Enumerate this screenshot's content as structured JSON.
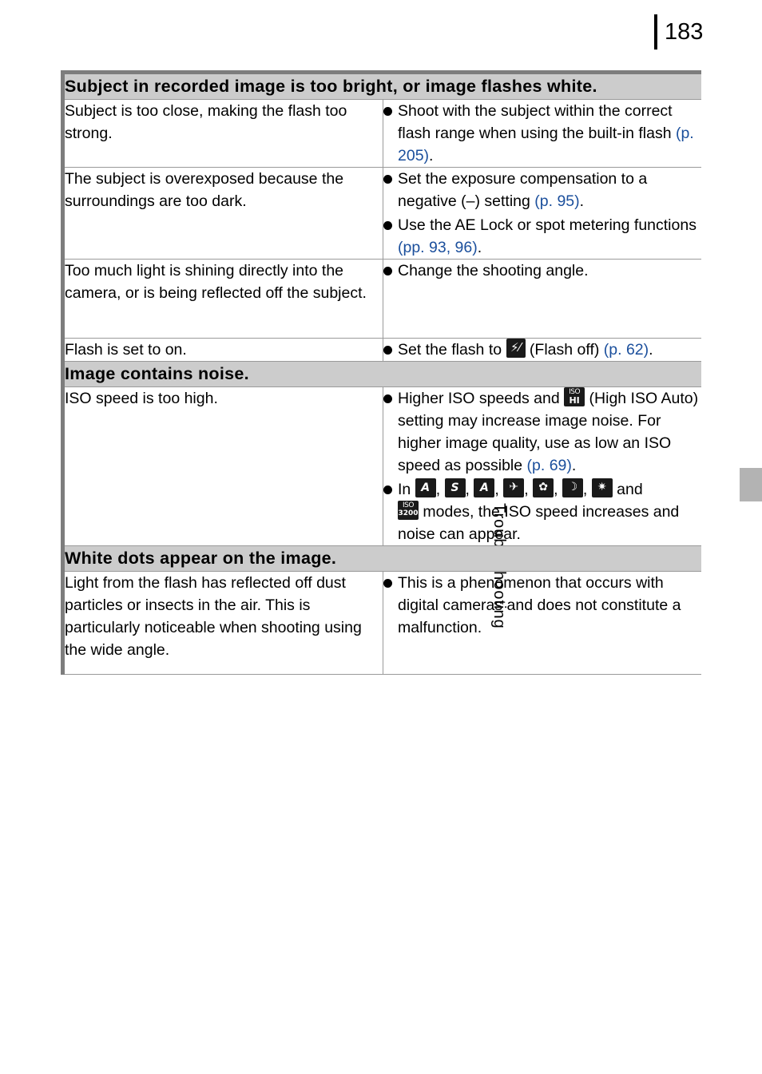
{
  "page": {
    "number": "183",
    "side_tab_label": "Troubleshooting"
  },
  "sections": [
    {
      "heading": "Subject in recorded image is too bright, or image flashes white.",
      "rows": [
        {
          "cause": "Subject is too close, making the flash too strong.",
          "remedies": [
            {
              "pre": "Shoot with the subject within the correct flash range when using the built-in flash ",
              "ref": "(p. 205)",
              "post": "."
            }
          ]
        },
        {
          "cause": "The subject is overexposed because the surroundings are too dark.",
          "remedies": [
            {
              "pre": "Set the exposure compensation to a negative (–) setting ",
              "ref": "(p. 95)",
              "post": "."
            },
            {
              "pre": "Use the AE Lock or spot metering functions ",
              "ref": "(pp. 93, 96)",
              "post": "."
            }
          ]
        },
        {
          "cause": "Too much light is shining directly into the camera, or is being reflected off the subject.",
          "remedies": [
            {
              "pre": "Change the shooting angle.",
              "ref": "",
              "post": ""
            }
          ]
        },
        {
          "cause": "Flash is set to on.",
          "remedies": [
            {
              "pre": "Set the flash to ",
              "icon": "flash-off-icon",
              "mid": " (Flash off) ",
              "ref": "(p. 62)",
              "post": "."
            }
          ]
        }
      ]
    },
    {
      "heading": "Image contains noise.",
      "rows": [
        {
          "cause": "ISO speed is too high.",
          "remedies": [
            {
              "pre": "Higher ISO speeds and ",
              "icon": "iso-hi-icon",
              "mid": " (High ISO Auto) setting may increase image noise. For higher image quality, use as low an ISO speed as possible ",
              "ref": "(p. 69)",
              "post": "."
            },
            {
              "pre": "In ",
              "icons": [
                "auto-iso-icon",
                "long-shutter-icon",
                "indoor-icon",
                "kids-pets-icon",
                "foliage-icon",
                "night-snapshot-icon",
                "fireworks-icon"
              ],
              "mid": " and ",
              "icon_last": "iso-3200-icon",
              "post": " modes, the ISO speed increases and noise can appear."
            }
          ]
        }
      ]
    },
    {
      "heading": "White dots appear on the image.",
      "rows": [
        {
          "cause": "Light from the flash has reflected off dust particles or insects in the air. This is particularly noticeable when shooting using the wide angle.",
          "remedies": [
            {
              "pre": "This is a phenomenon that occurs with digital cameras and does not constitute a malfunction.",
              "ref": "",
              "post": ""
            }
          ]
        }
      ]
    }
  ],
  "icon_labels": {
    "flash-off-icon": "flash-off",
    "iso-hi-icon": "ISO HI",
    "iso-3200-icon": "ISO 3200",
    "auto-iso-icon": "auto",
    "long-shutter-icon": "long-shutter",
    "indoor-icon": "indoor",
    "kids-pets-icon": "kids-and-pets",
    "foliage-icon": "foliage",
    "night-snapshot-icon": "night-snapshot",
    "fireworks-icon": "fireworks"
  },
  "colors": {
    "reference_link": "#1b4f9c",
    "section_header_bg": "#cccccc",
    "rule": "#7d7d7d",
    "tab": "#b3b3b3"
  }
}
